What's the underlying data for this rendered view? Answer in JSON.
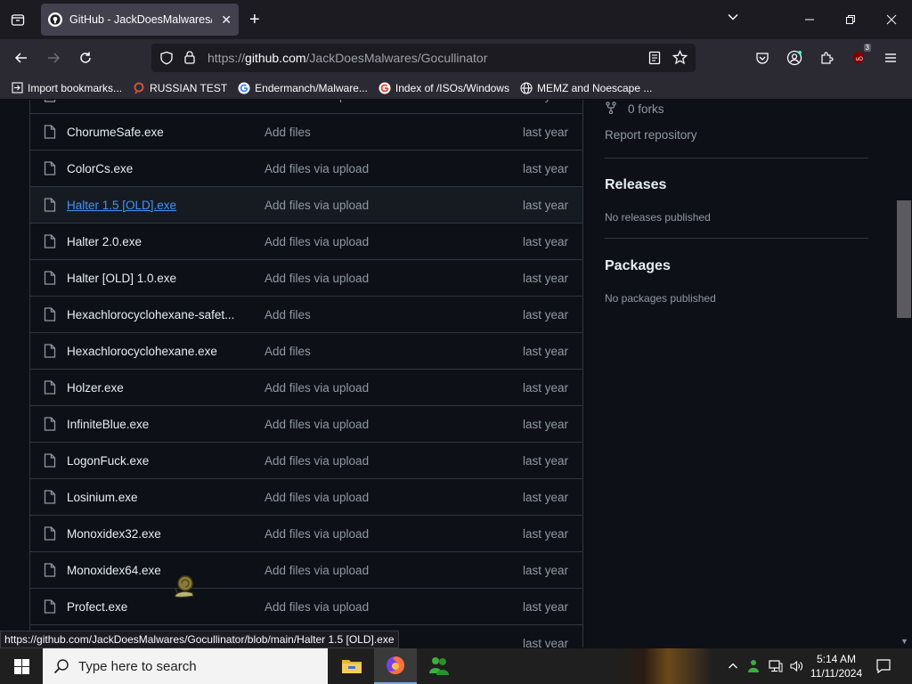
{
  "browser": {
    "tab_title": "GitHub - JackDoesMalwares/Gocullinator",
    "url_prefix": "https://",
    "url_domain": "github.com",
    "url_path": "/JackDoesMalwares/Gocullinator",
    "extension_badge": "3",
    "bookmarks": [
      {
        "label": "Import bookmarks...",
        "icon": "import-icon"
      },
      {
        "label": "RUSSIAN TEST",
        "icon": "search-ring-icon"
      },
      {
        "label": "Endermanch/Malware...",
        "icon": "google-icon"
      },
      {
        "label": "Index of /ISOs/Windows",
        "icon": "google-icon"
      },
      {
        "label": "MEMZ and Noescape ...",
        "icon": "globe-icon"
      }
    ],
    "status_link": "https://github.com/JackDoesMalwares/Gocullinator/blob/main/Halter 1.5 [OLD].exe"
  },
  "files": [
    {
      "name": "ChorumeDestructive.exe",
      "message": "Add files via upload",
      "age": "last year"
    },
    {
      "name": "ChorumeSafe.exe",
      "message": "Add files",
      "age": "last year"
    },
    {
      "name": "ColorCs.exe",
      "message": "Add files via upload",
      "age": "last year"
    },
    {
      "name": "Halter 1.5 [OLD].exe",
      "message": "Add files via upload",
      "age": "last year"
    },
    {
      "name": "Halter 2.0.exe",
      "message": "Add files via upload",
      "age": "last year"
    },
    {
      "name": "Halter [OLD] 1.0.exe",
      "message": "Add files via upload",
      "age": "last year"
    },
    {
      "name": "Hexachlorocyclohexane-safet...",
      "message": "Add files",
      "age": "last year"
    },
    {
      "name": "Hexachlorocyclohexane.exe",
      "message": "Add files",
      "age": "last year"
    },
    {
      "name": "Holzer.exe",
      "message": "Add files via upload",
      "age": "last year"
    },
    {
      "name": "InfiniteBlue.exe",
      "message": "Add files via upload",
      "age": "last year"
    },
    {
      "name": "LogonFuck.exe",
      "message": "Add files via upload",
      "age": "last year"
    },
    {
      "name": "Losinium.exe",
      "message": "Add files via upload",
      "age": "last year"
    },
    {
      "name": "Monoxidex32.exe",
      "message": "Add files via upload",
      "age": "last year"
    },
    {
      "name": "Monoxidex64.exe",
      "message": "Add files via upload",
      "age": "last year"
    },
    {
      "name": "Profect.exe",
      "message": "Add files via upload",
      "age": "last year"
    },
    {
      "name": "",
      "message": "",
      "age": "last year"
    }
  ],
  "sidebar": {
    "forks": "0 forks",
    "report": "Report repository",
    "releases_title": "Releases",
    "releases_empty": "No releases published",
    "packages_title": "Packages",
    "packages_empty": "No packages published"
  },
  "taskbar": {
    "search_placeholder": "Type here to search",
    "time": "5:14 AM",
    "date": "11/11/2024"
  }
}
